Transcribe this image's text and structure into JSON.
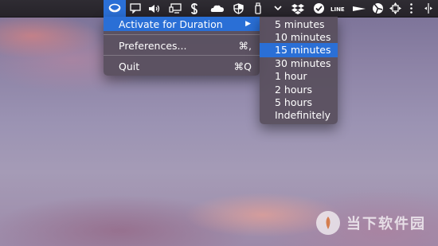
{
  "menubar": {
    "icons": [
      "amphetamine-icon",
      "message-bubble-icon",
      "volume-icon",
      "display-icon",
      "dollar-icon",
      "onedrive-cloud-icon",
      "shield-icon",
      "usb-drive-icon",
      "chevron-down-icon",
      "dropbox-icon",
      "checkmark-circle-icon",
      "line-app-icon",
      "tracker-icon",
      "pie-chart-icon",
      "move-arrows-icon",
      "menu-icon",
      "split-icon"
    ],
    "accent_color": "#2a6fd6"
  },
  "main_menu": {
    "activate_label": "Activate for Duration",
    "activate_arrow": "▶",
    "preferences_label": "Preferences...",
    "preferences_shortcut": "⌘,",
    "quit_label": "Quit",
    "quit_shortcut": "⌘Q"
  },
  "duration_menu": {
    "items": [
      "5 minutes",
      "10 minutes",
      "15 minutes",
      "30 minutes",
      "1 hour",
      "2 hours",
      "5 hours",
      "Indefinitely"
    ],
    "selected": "15 minutes"
  },
  "watermark": {
    "text": "当下软件园"
  }
}
